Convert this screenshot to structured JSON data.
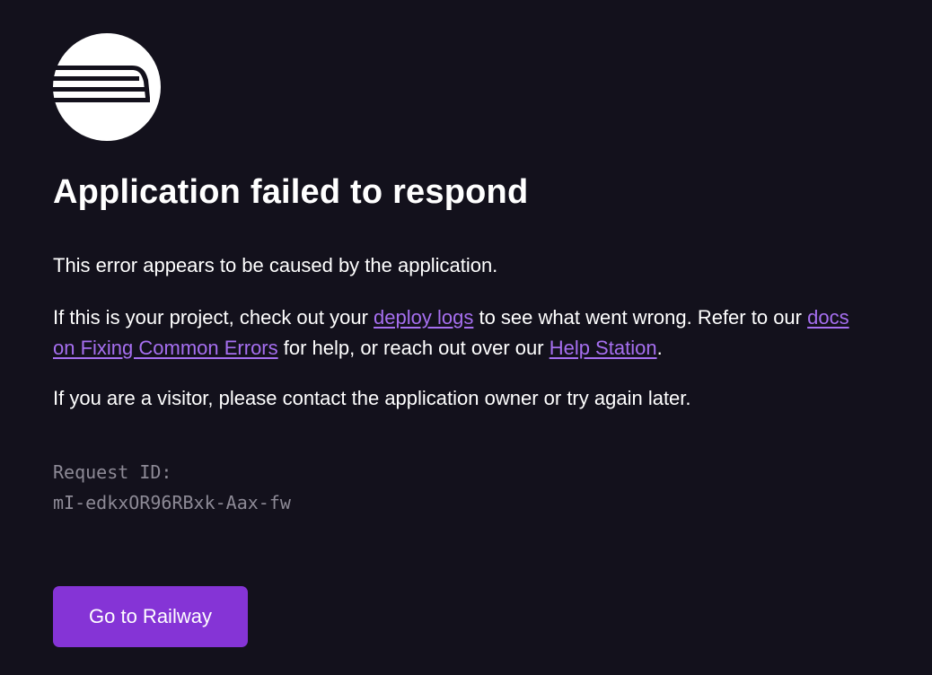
{
  "logo": {
    "icon": "railway-logo-icon"
  },
  "title": "Application failed to respond",
  "paragraph1": "This error appears to be caused by the application.",
  "paragraph2": {
    "text_before_deploy_logs": "If this is your project, check out your ",
    "deploy_logs_link": "deploy logs",
    "text_after_deploy_logs": " to see what went wrong. Refer to our ",
    "docs_link": "docs on Fixing Common Errors",
    "text_after_docs": " for help, or reach out over our ",
    "help_station_link": "Help Station",
    "text_end": "."
  },
  "paragraph3": "If you are a visitor, please contact the application owner or try again later.",
  "request": {
    "label": "Request ID:",
    "id": "mI-edkxOR96RBxk-Aax-fw"
  },
  "button": {
    "label": "Go to Railway"
  },
  "colors": {
    "background": "#13111c",
    "text": "#ffffff",
    "link": "#a66ff0",
    "muted": "#8d8a96",
    "button": "#8534d6"
  }
}
